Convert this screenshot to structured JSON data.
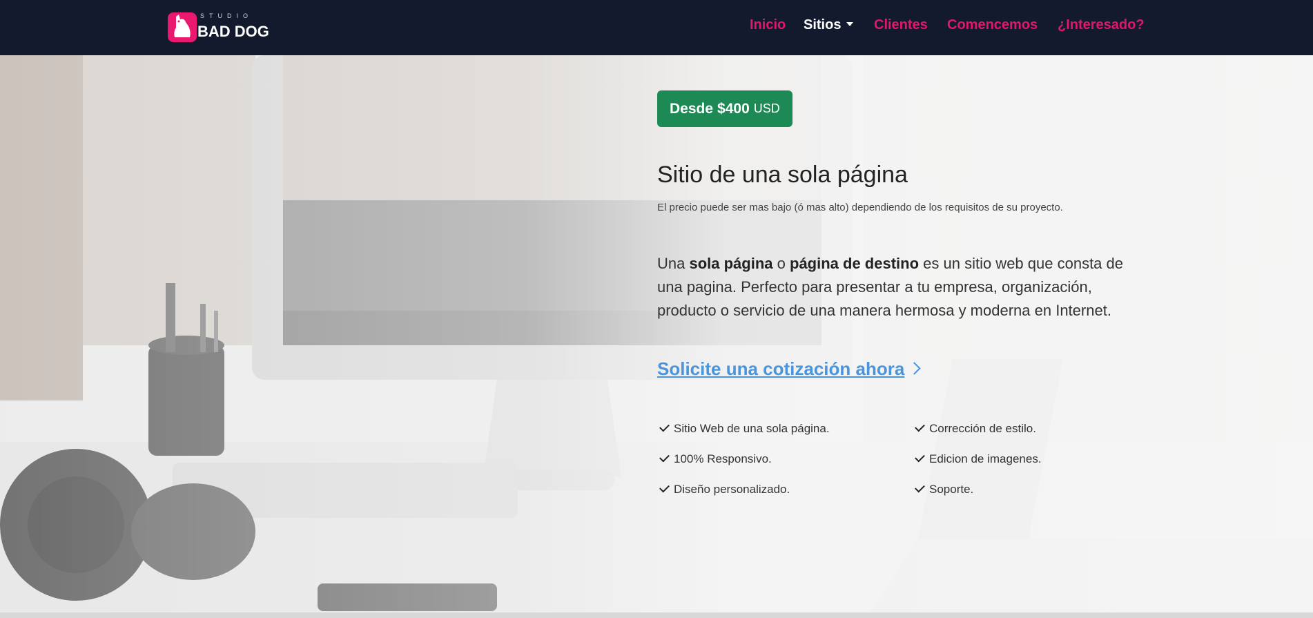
{
  "brand": {
    "small": "STUDIO",
    "name": "BAD DOG",
    "accent": "#e8196e"
  },
  "nav": {
    "items": [
      {
        "label": "Inicio"
      },
      {
        "label": "Sitios"
      },
      {
        "label": "Clientes"
      },
      {
        "label": "Comencemos"
      },
      {
        "label": "¿Interesado?"
      }
    ]
  },
  "hero": {
    "price": {
      "prefix": "Desde",
      "amount": "$400",
      "unit": "USD",
      "color": "#1d8a55"
    },
    "title": "Sitio de una sola página",
    "subtitle": "El precio puede ser mas bajo (ó mas alto) dependiendo de los requisitos de su proyecto.",
    "description": {
      "p1": "Una ",
      "b1": "sola página",
      "p2": " o ",
      "b2": "página de destino",
      "p3": " es un sitio web que consta de una pagina. Perfecto para presentar a tu empresa, organización, producto o servicio de una manera hermosa y moderna en Internet."
    },
    "cta": {
      "label": "Solicite una cotización ahora",
      "color": "#4a94db"
    },
    "features": [
      "Sitio Web de una sola página.",
      "Corrección de estilo.",
      "100% Responsivo.",
      "Edicion de imagenes.",
      "Diseño personalizado.",
      "Soporte."
    ]
  }
}
